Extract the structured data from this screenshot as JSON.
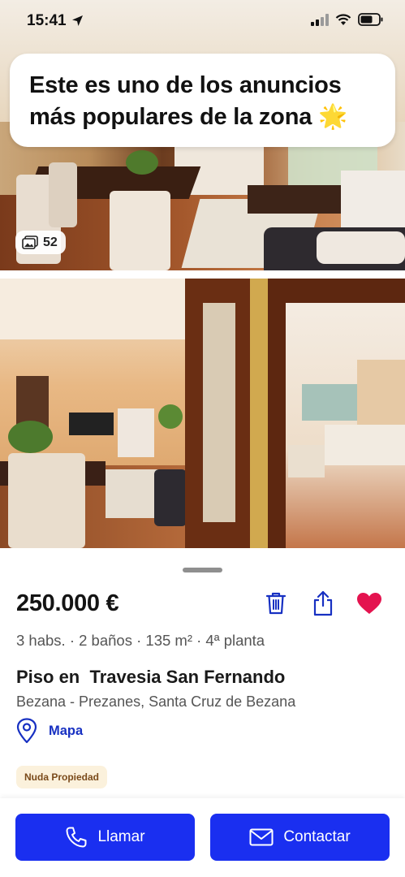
{
  "status_bar": {
    "time": "15:41",
    "location_icon": "location-arrow-icon",
    "signal_icon": "cellular-signal-icon",
    "wifi_icon": "wifi-icon",
    "battery_icon": "battery-icon"
  },
  "gallery": {
    "promo_text": "Este es uno de los anuncios más populares de la zona 🌟",
    "photo_count": "52",
    "photo_count_icon": "photos-icon"
  },
  "listing": {
    "price": "250.000 €",
    "features": "3 habs. · 2 baños · 135 m² · 4ª planta",
    "title": "Piso en  Travesia San Fernando",
    "location": "Bezana - Prezanes, Santa Cruz de Bezana",
    "map_label": "Mapa",
    "badge": "Nuda Propiedad",
    "actions": {
      "delete_icon": "trash-icon",
      "share_icon": "share-icon",
      "favorite_icon": "heart-icon"
    }
  },
  "footer": {
    "call_label": "Llamar",
    "contact_label": "Contactar"
  },
  "colors": {
    "primary": "#1a2ff0",
    "link": "#1730c2",
    "favorite": "#e4134f",
    "badge_bg": "#fbf1dc"
  }
}
